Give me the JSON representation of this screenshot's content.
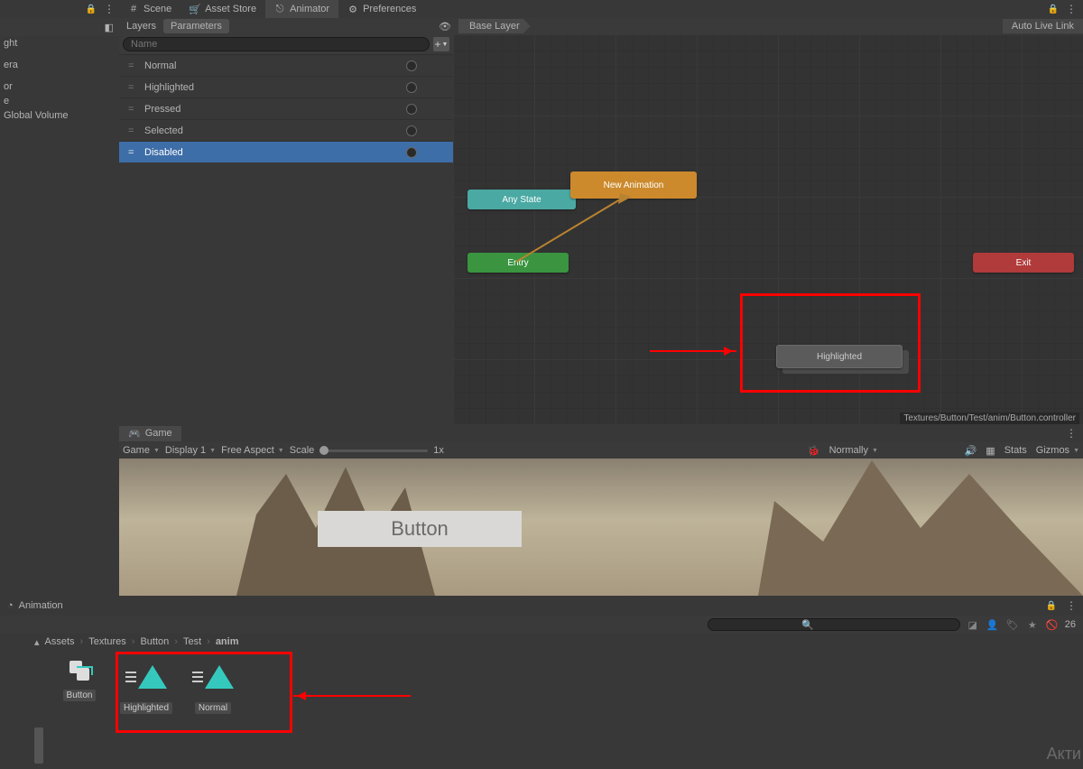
{
  "topLeft": {
    "lock": "🔒",
    "menu": "⋮"
  },
  "tabs": [
    {
      "label": "Scene",
      "icon": "#"
    },
    {
      "label": "Asset Store",
      "icon": "🛒"
    },
    {
      "label": "Animator",
      "icon": "⎋",
      "active": true
    },
    {
      "label": "Preferences",
      "icon": "⚙"
    }
  ],
  "topRight": {
    "lock": "🔒",
    "menu": "⋮"
  },
  "hierarchy": {
    "items": [
      "ght",
      "",
      "",
      "era",
      "",
      "",
      "or",
      "e",
      "Global Volume"
    ]
  },
  "subTabs": {
    "layers": "Layers",
    "parameters": "Parameters"
  },
  "breadcrumb": "Base Layer",
  "autoLive": "Auto Live Link",
  "paramSearch": {
    "placeholder": "Name",
    "icon": "🔍",
    "plus": "+"
  },
  "params": [
    {
      "name": "Normal"
    },
    {
      "name": "Highlighted"
    },
    {
      "name": "Pressed"
    },
    {
      "name": "Selected"
    },
    {
      "name": "Disabled",
      "selected": true
    }
  ],
  "nodes": {
    "anyState": "Any State",
    "newAnim": "New Animation",
    "entry": "Entry",
    "exit": "Exit",
    "highlighted": "Highlighted"
  },
  "graphPath": "Textures/Button/Test/anim/Button.controller",
  "gameTab": "Game",
  "gameToolbar": {
    "mode": "Game",
    "display": "Display 1",
    "aspect": "Free Aspect",
    "scaleLabel": "Scale",
    "scaleValue": "1x",
    "normally": "Normally",
    "stats": "Stats",
    "gizmos": "Gizmos"
  },
  "uiButton": "Button",
  "animPanel": "Animation",
  "hiddenCount": "26",
  "projPath": [
    "Assets",
    "Textures",
    "Button",
    "Test",
    "anim"
  ],
  "assets": [
    {
      "label": "Button",
      "type": "controller"
    },
    {
      "label": "Highlighted",
      "type": "clip"
    },
    {
      "label": "Normal",
      "type": "clip"
    }
  ],
  "watermark": "Акти"
}
